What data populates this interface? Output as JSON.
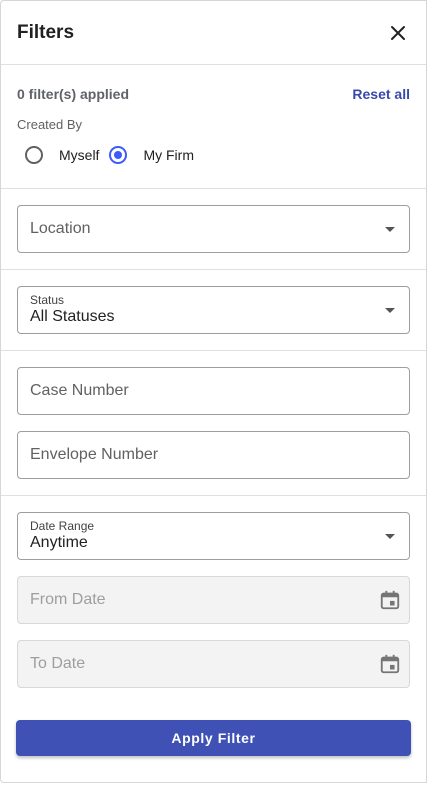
{
  "header": {
    "title": "Filters",
    "close_icon": "close-icon"
  },
  "summary": {
    "applied_text": "0 filter(s) applied",
    "reset_label": "Reset all"
  },
  "created_by": {
    "label": "Created By",
    "options": [
      {
        "label": "Myself",
        "checked": false
      },
      {
        "label": "My Firm",
        "checked": true
      }
    ]
  },
  "location": {
    "placeholder": "Location"
  },
  "status": {
    "label": "Status",
    "value": "All Statuses"
  },
  "case_number": {
    "placeholder": "Case Number"
  },
  "envelope_number": {
    "placeholder": "Envelope Number"
  },
  "date_range": {
    "label": "Date Range",
    "value": "Anytime"
  },
  "from_date": {
    "placeholder": "From Date",
    "icon": "calendar-icon"
  },
  "to_date": {
    "placeholder": "To Date",
    "icon": "calendar-icon"
  },
  "apply": {
    "label": "Apply Filter"
  },
  "colors": {
    "accent": "#3f51b5",
    "radio_selected": "#3d5afe",
    "link": "#3949ab"
  }
}
